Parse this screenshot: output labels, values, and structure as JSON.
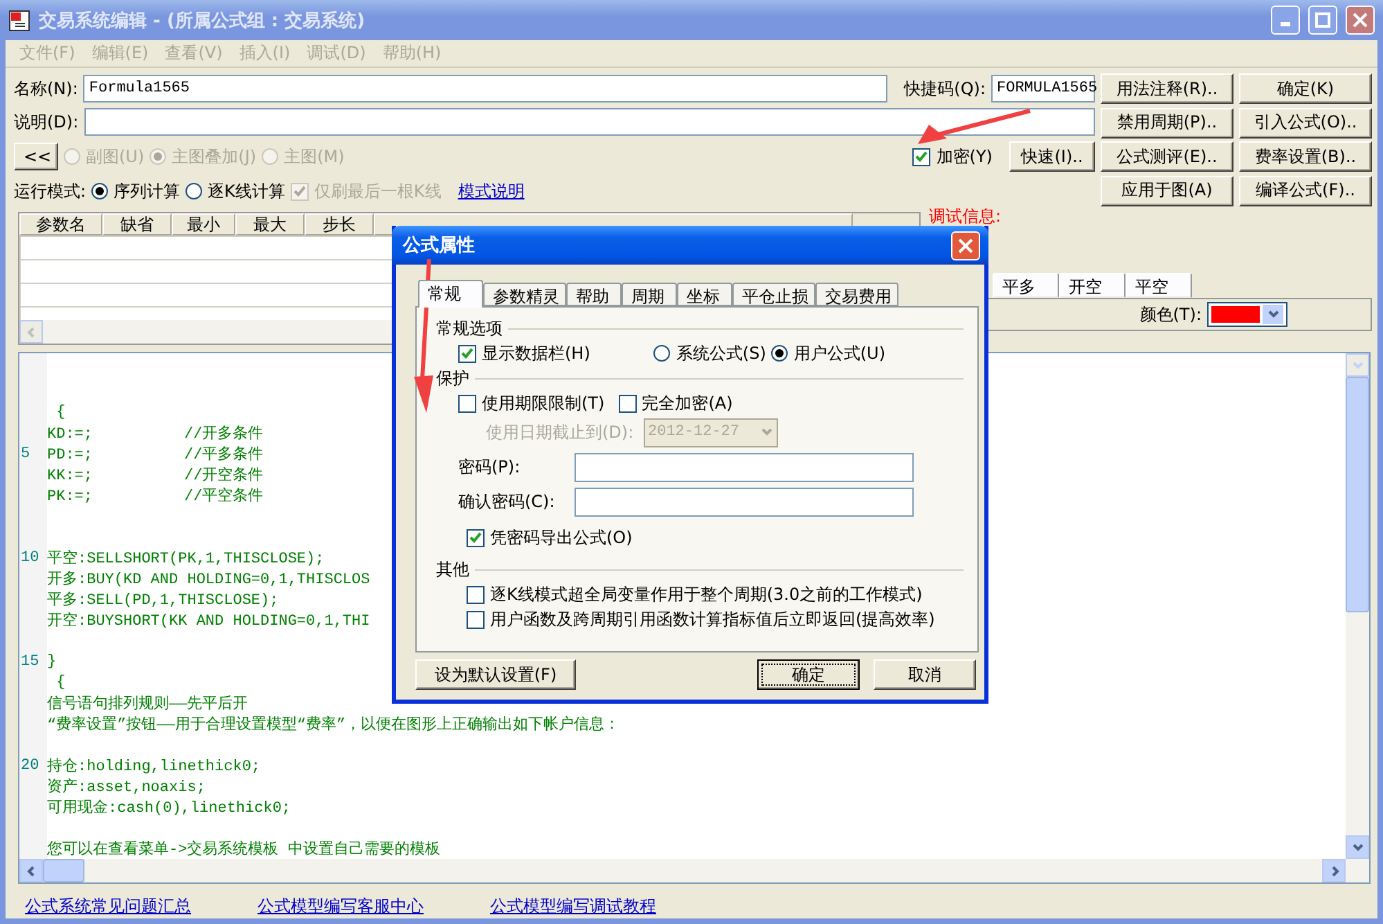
{
  "window": {
    "title": "交易系统编辑 - (所属公式组 : 交易系统)"
  },
  "menu": [
    "文件(F)",
    "编辑(E)",
    "查看(V)",
    "插入(I)",
    "调试(D)",
    "帮助(H)"
  ],
  "name_field": {
    "label": "名称(N):",
    "value": "Formula1565"
  },
  "shortcut_field": {
    "label": "快捷码(Q):",
    "value": "FORMULA1565"
  },
  "description_field": {
    "label": "说明(D):"
  },
  "collapse_button": "<<",
  "chart_type": [
    {
      "label": "副图(U)",
      "selected": false,
      "disabled": true
    },
    {
      "label": "主图叠加(J)",
      "selected": true,
      "disabled": true
    },
    {
      "label": "主图(M)",
      "selected": false,
      "disabled": true
    }
  ],
  "encrypt": {
    "label": "加密(Y)",
    "checked": true
  },
  "quick_button": "快速(I)..",
  "run_mode": {
    "label": "运行模式:",
    "options": [
      {
        "label": "序列计算",
        "selected": true
      },
      {
        "label": "逐K线计算",
        "selected": false
      }
    ],
    "refresh_last": {
      "label": "仅刷最后一根K线",
      "checked": true,
      "disabled": true
    },
    "link": "模式说明"
  },
  "buttons": [
    "用法注释(R)..",
    "确定(K)",
    "禁用周期(P)..",
    "引入公式(O)..",
    "公式测评(E)..",
    "费率设置(B)..",
    "应用于图(A)",
    "编译公式(F).."
  ],
  "params_table": {
    "columns": [
      "参数名",
      "缺省",
      "最小",
      "最大",
      "步长"
    ]
  },
  "debug_label": "调试信息:",
  "signal_tabs": [
    "平多",
    "开空",
    "平空"
  ],
  "color_picker": {
    "label": "颜色(T):",
    "color": "#ff0000"
  },
  "editor": {
    "lines": [
      {
        "kind": "blank"
      },
      {
        "kind": "blank"
      },
      {
        "kind": "code",
        "text": " {"
      },
      {
        "kind": "code",
        "text": "KD:=;          //开多条件"
      },
      {
        "kind": "code",
        "number": "5",
        "text": "PD:=;          //平多条件"
      },
      {
        "kind": "code",
        "text": "KK:=;          //开空条件"
      },
      {
        "kind": "code",
        "text": "PK:=;          //平空条件"
      },
      {
        "kind": "blank"
      },
      {
        "kind": "blank"
      },
      {
        "kind": "code",
        "number": "10",
        "text": "平空:SELLSHORT(PK,1,THISCLOSE);"
      },
      {
        "kind": "code",
        "text": "开多:BUY(KD AND HOLDING=0,1,THISCLOS"
      },
      {
        "kind": "code",
        "text": "平多:SELL(PD,1,THISCLOSE);"
      },
      {
        "kind": "code",
        "text": "开空:BUYSHORT(KK AND HOLDING=0,1,THI"
      },
      {
        "kind": "blank"
      },
      {
        "kind": "code",
        "number": "15",
        "text": "}"
      },
      {
        "kind": "code",
        "text": " {"
      },
      {
        "kind": "code",
        "text": "信号语句排列规则——先平后开"
      },
      {
        "kind": "code",
        "text": "“费率设置”按钮——用于合理设置模型“费率”，以便在图形上正确输出如下帐户信息："
      },
      {
        "kind": "blank"
      },
      {
        "kind": "code",
        "number": "20",
        "text": "持仓:holding,linethick0;"
      },
      {
        "kind": "code",
        "text": "资产:asset,noaxis;"
      },
      {
        "kind": "code",
        "text": "可用现金:cash(0),linethick0;"
      },
      {
        "kind": "blank"
      },
      {
        "kind": "code",
        "text": "您可以在查看菜单->交易系统模板 中设置自己需要的模板"
      }
    ]
  },
  "links": [
    "公式系统常见问题汇总",
    "公式模型编写客服中心",
    "公式模型编写调试教程"
  ],
  "dialog": {
    "title": "公式属性",
    "tabs": [
      {
        "label": "常规",
        "selected": true
      },
      {
        "label": "参数精灵",
        "selected": false
      },
      {
        "label": "帮助",
        "selected": false
      },
      {
        "label": "周期",
        "selected": false
      },
      {
        "label": "坐标",
        "selected": false
      },
      {
        "label": "平仓止损",
        "selected": false
      },
      {
        "label": "交易费用",
        "selected": false
      }
    ],
    "general_group": {
      "title": "常规选项",
      "show_data_bar": {
        "label": "显示数据栏(H)",
        "checked": true
      },
      "formula_type": [
        {
          "label": "系统公式(S)",
          "selected": false
        },
        {
          "label": "用户公式(U)",
          "selected": true
        }
      ]
    },
    "protection_group": {
      "title": "保护",
      "time_limit": {
        "label": "使用期限限制(T)",
        "checked": false
      },
      "full_encrypt": {
        "label": "完全加密(A)",
        "checked": false
      },
      "expiry": {
        "label": "使用日期截止到(D):",
        "value": "2012-12-27",
        "disabled": true
      },
      "password": {
        "label": "密码(P):"
      },
      "confirm_password": {
        "label": "确认密码(C):"
      },
      "export_by_password": {
        "label": "凭密码导出公式(O)",
        "checked": true
      }
    },
    "other_group": {
      "title": "其他",
      "options": [
        {
          "label": "逐K线模式超全局变量作用于整个周期(3.0之前的工作模式)",
          "checked": false
        },
        {
          "label": "用户函数及跨周期引用函数计算指标值后立即返回(提高效率)",
          "checked": false
        }
      ]
    },
    "buttons": {
      "default": "设为默认设置(F)",
      "ok": "确定",
      "cancel": "取消"
    }
  }
}
